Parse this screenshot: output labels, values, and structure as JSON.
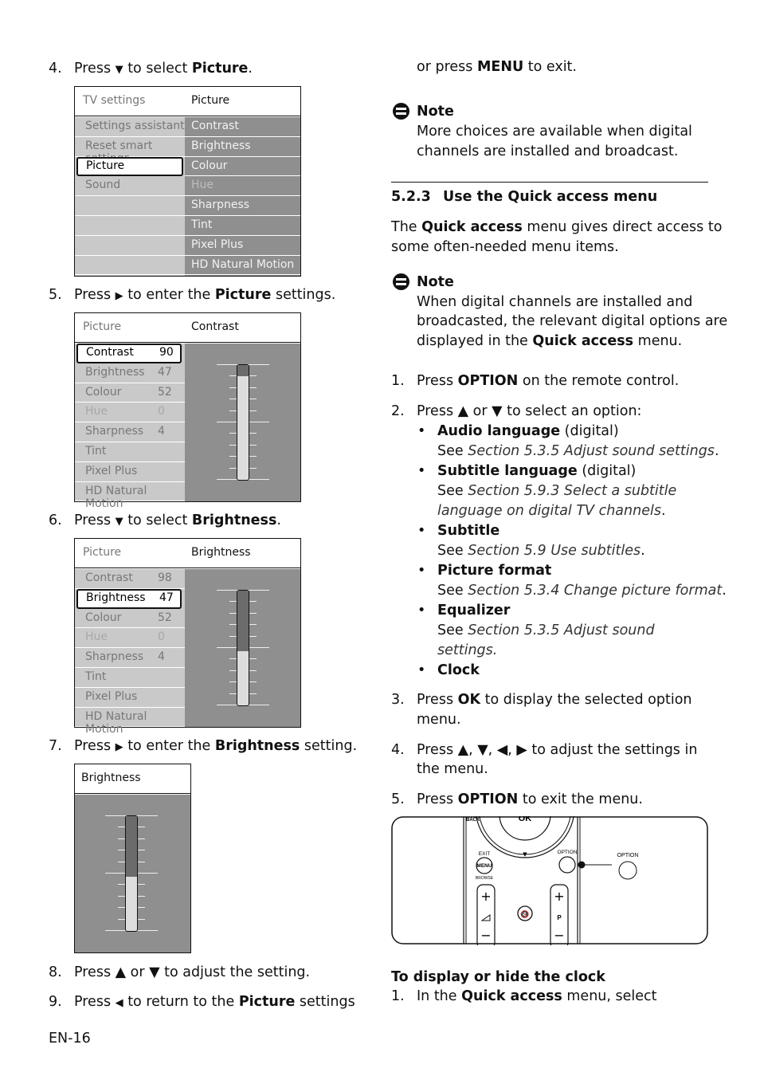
{
  "left_steps": [
    {
      "num": "4.",
      "pre": "Press ",
      "icon": "down-arrow",
      "mid": " to select ",
      "bold": "Picture",
      "post": "."
    },
    {
      "num": "5.",
      "pre": "Press ",
      "icon": "right-arrow",
      "mid": " to enter the ",
      "bold": "Picture",
      "post": " settings."
    },
    {
      "num": "6.",
      "pre": "Press ",
      "icon": "down-arrow",
      "mid": " to select ",
      "bold": "Brightness",
      "post": "."
    },
    {
      "num": "7.",
      "pre": "Press ",
      "icon": "right-arrow",
      "mid": " to enter the ",
      "bold": "Brightness",
      "post": " setting."
    },
    {
      "num": "8.",
      "text": "Press ▲ or ▼ to adjust the setting."
    },
    {
      "num": "9.",
      "pre": "Press ",
      "icon": "left-arrow",
      "mid": " to return to the ",
      "bold": "Picture",
      "post": " settings"
    }
  ],
  "glyphs": {
    "down": "▼",
    "right": "▶",
    "left": "◀",
    "up": "▲"
  },
  "menu1": {
    "header_left": "TV settings",
    "header_right": "Picture",
    "left_items": [
      "Settings assistant",
      "Reset smart settings",
      "Picture",
      "Sound",
      "",
      "",
      "",
      ""
    ],
    "right_items": [
      "Contrast",
      "Brightness",
      "Colour",
      "Hue",
      "Sharpness",
      "Tint",
      "Pixel Plus",
      "HD Natural Motion"
    ],
    "selected_left": "Picture"
  },
  "menu2": {
    "header_left": "Picture",
    "header_right": "Contrast",
    "items": [
      [
        "Contrast",
        "90"
      ],
      [
        "Brightness",
        "47"
      ],
      [
        "Colour",
        "52"
      ],
      [
        "Hue",
        "0"
      ],
      [
        "Sharpness",
        "4"
      ],
      [
        "Tint",
        ""
      ],
      [
        "Pixel Plus",
        ""
      ],
      [
        "HD Natural Motion",
        ""
      ]
    ],
    "selected": "Contrast",
    "slider_value": 90
  },
  "menu3": {
    "header_left": "Picture",
    "header_right": "Brightness",
    "items": [
      [
        "Contrast",
        "98"
      ],
      [
        "Brightness",
        "47"
      ],
      [
        "Colour",
        "52"
      ],
      [
        "Hue",
        "0"
      ],
      [
        "Sharpness",
        "4"
      ],
      [
        "Tint",
        ""
      ],
      [
        "Pixel Plus",
        ""
      ],
      [
        "HD Natural Motion",
        ""
      ]
    ],
    "selected": "Brightness",
    "slider_value": 47
  },
  "menu4": {
    "header": "Brightness",
    "slider_value": 47
  },
  "right": {
    "exit_line": {
      "pre": "or press ",
      "bold": "MENU",
      "post": " to exit."
    },
    "note1": {
      "title": "Note",
      "lines": [
        "More choices are available when digital",
        "channels are installed and broadcast."
      ]
    },
    "section": {
      "number": "5.2.3",
      "title": "Use the Quick access menu"
    },
    "intro": {
      "l1_pre": "The ",
      "l1_bold": "Quick access",
      "l1_post": " menu gives direct access to",
      "l2": "some often-needed menu items."
    },
    "note2": {
      "title": "Note",
      "l1": "When digital channels are installed and",
      "l2": "broadcasted, the relevant digital options are",
      "l3_pre": "displayed in the ",
      "l3_bold": "Quick access",
      "l3_post": " menu."
    },
    "step1": {
      "num": "1.",
      "pre": "Press ",
      "bold": "OPTION",
      "post": " on the remote control."
    },
    "step2": {
      "num": "2.",
      "text": "Press ▲ or ▼ to select an option:"
    },
    "options": [
      {
        "bold": "Audio language",
        "suffix": " (digital)",
        "see": [
          "See ",
          "Section 5.3.5 Adjust sound settings",
          "."
        ]
      },
      {
        "bold": "Subtitle language",
        "suffix": " (digital)",
        "see": [
          "See ",
          "Section 5.9.3 Select a subtitle",
          ""
        ],
        "see2": [
          "language on digital TV channels",
          "."
        ]
      },
      {
        "bold": "Subtitle",
        "suffix": "",
        "see": [
          "See ",
          "Section 5.9 Use subtitles",
          "."
        ]
      },
      {
        "bold": "Picture format",
        "suffix": "",
        "see": [
          "See ",
          "Section 5.3.4 Change picture format",
          "."
        ]
      },
      {
        "bold": "Equalizer",
        "suffix": "",
        "see": [
          "See ",
          "Section 5.3.5 Adjust sound",
          ""
        ],
        "see2": [
          "settings.",
          ""
        ]
      },
      {
        "bold": "Clock",
        "suffix": ""
      }
    ],
    "bullet": "•",
    "step3": {
      "num": "3.",
      "pre": "Press ",
      "bold": "OK",
      "post": " to display the selected option",
      "l2": "menu."
    },
    "step4": {
      "num": "4.",
      "text": "Press ▲, ▼, ◀, ▶ to adjust the settings in",
      "l2": "the menu."
    },
    "step5": {
      "num": "5.",
      "pre": "Press ",
      "bold": "OPTION",
      "post": " to exit the menu."
    },
    "remote": {
      "back": "BACK",
      "ok": "OK",
      "exit": "EXIT",
      "menu": "MENU",
      "browse": "BROWSE",
      "option": "OPTION",
      "option_callout": "OPTION",
      "p": "P",
      "plus": "+",
      "minus": "−"
    },
    "clock": {
      "heading": "To display or hide the clock",
      "num": "1.",
      "pre": "In the ",
      "bold": "Quick access",
      "post": " menu, select"
    }
  },
  "footer": {
    "page_number": "EN-16"
  }
}
